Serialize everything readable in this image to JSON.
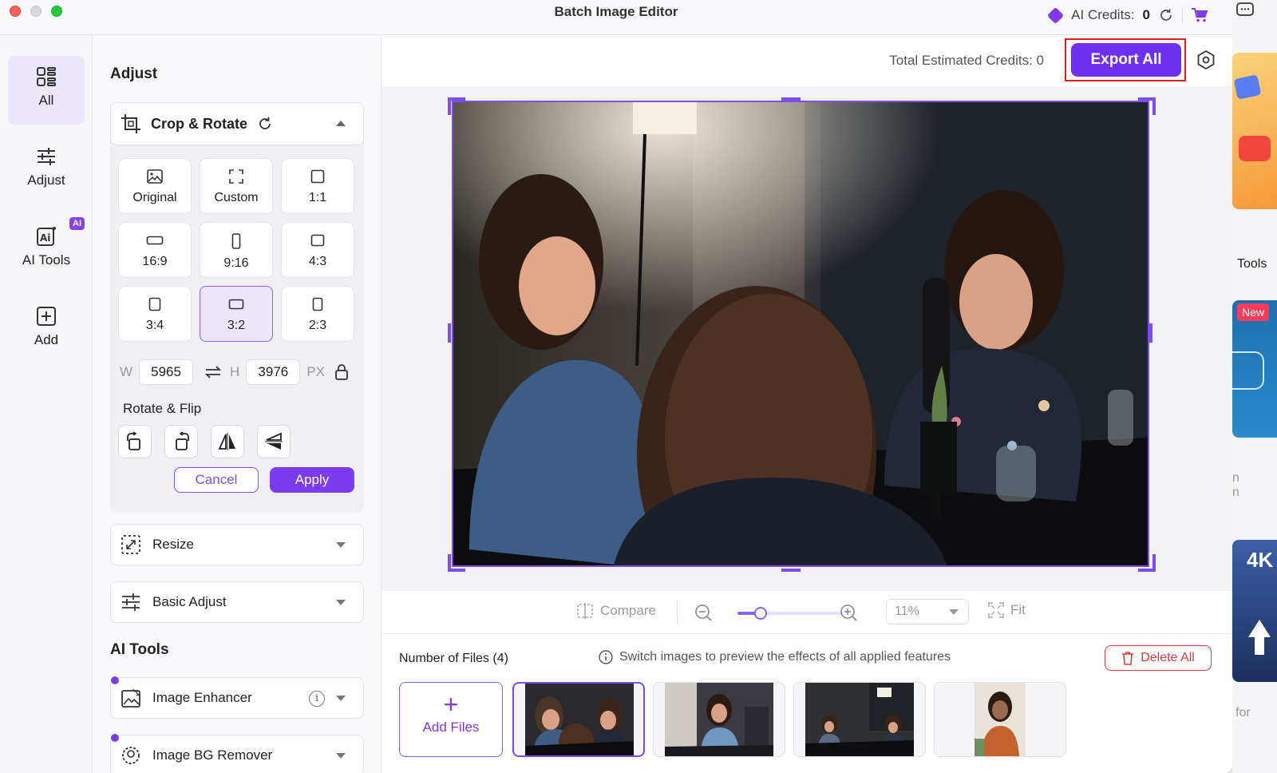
{
  "window": {
    "title": "Batch Image Editor"
  },
  "credits": {
    "label": "AI Credits:",
    "value": "0"
  },
  "nav": [
    {
      "label": "All",
      "icon": "grid-icon"
    },
    {
      "label": "Adjust",
      "icon": "sliders-icon"
    },
    {
      "label": "AI Tools",
      "icon": "ai-icon",
      "badge": "AI"
    },
    {
      "label": "Add",
      "icon": "add-icon"
    }
  ],
  "panel": {
    "title": "Adjust",
    "crop": {
      "label": "Crop & Rotate",
      "ratios": [
        {
          "label": "Original",
          "icon": "image-icon"
        },
        {
          "label": "Custom",
          "icon": "custom-crop-icon"
        },
        {
          "label": "1:1",
          "icon": "square-icon"
        },
        {
          "label": "16:9",
          "icon": "landscape-icon"
        },
        {
          "label": "9:16",
          "icon": "portrait-icon"
        },
        {
          "label": "4:3",
          "icon": "ratio-icon"
        },
        {
          "label": "3:4",
          "icon": "ratio-icon"
        },
        {
          "label": "3:2",
          "icon": "ratio-icon",
          "selected": true
        },
        {
          "label": "2:3",
          "icon": "ratio-icon"
        }
      ],
      "w_label": "W",
      "width": "5965",
      "h_label": "H",
      "height": "3976",
      "unit": "PX",
      "rotate_flip": "Rotate & Flip",
      "cancel": "Cancel",
      "apply": "Apply"
    },
    "resize": "Resize",
    "basic_adjust": "Basic Adjust",
    "ai_tools_title": "AI Tools",
    "image_enhancer": "Image Enhancer",
    "bg_remover": "Image BG Remover"
  },
  "workspace": {
    "total_credits": "Total Estimated Credits: 0",
    "export_all": "Export All",
    "compare": "Compare",
    "zoom": "11%",
    "zoom_level": 0.22,
    "fit": "Fit",
    "files_count": "Number of Files (4)",
    "files_hint": "Switch images to preview the effects of all applied features",
    "delete_all": "Delete All",
    "add_files": "Add Files"
  },
  "background_window": {
    "tools_text": "Tools",
    "new_badge": "New",
    "fourk": "4K",
    "for_text": "for",
    "n1": "n",
    "n2": "n"
  },
  "colors": {
    "accent": "#7b3cf0",
    "danger": "#e03a3a",
    "highlight_frame": "#e02020"
  }
}
